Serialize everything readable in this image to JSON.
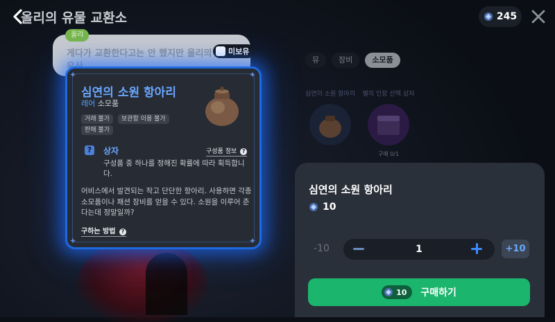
{
  "header": {
    "title": "올리의 유물 교환소",
    "currency_amount": "245"
  },
  "npc_bubble": {
    "tag": "올리",
    "text": "게다가 교환한다고는 안 했지만 올리의 소중한 유산 ...",
    "owned_label": "미보유"
  },
  "shop": {
    "tabs": [
      {
        "label": "뮤"
      },
      {
        "label": "장비"
      },
      {
        "label": "소모품"
      }
    ],
    "items": [
      {
        "name": "심연의 소원 항아리",
        "limit": ""
      },
      {
        "name": "별의 인장 선택 상자",
        "limit": "구매 0/1"
      }
    ]
  },
  "tooltip": {
    "item_name": "심연의 소원 항아리",
    "grade": "레어",
    "category": "소모품",
    "tags": [
      "거래 불가",
      "보관함 이용 불가",
      "판매 불가"
    ],
    "section_icon": "?",
    "section_title": "상자",
    "section_info": "구성품 정보",
    "section_desc": "구성품 중 하나를 정해진 확률에 따라 획득합니다.",
    "flavor": "어비스에서 발견되는 작고 단단한 항아리. 사용하면 각종 소모품이나 패션 장비를 얻을 수 있다. 소원을 이루어 준다는데 정말일까?",
    "how_to_obtain": "구하는 방법"
  },
  "purchase": {
    "item_name": "심연의 소원 항아리",
    "unit_price": "10",
    "minus10_label": "-10",
    "quantity": "1",
    "plus10_label": "+10",
    "total_cost": "10",
    "buy_label": "구매하기"
  },
  "colors": {
    "accent_blue": "#1e6ae0",
    "buy_green": "#1cb56d",
    "rare": "#5aa3ff"
  }
}
